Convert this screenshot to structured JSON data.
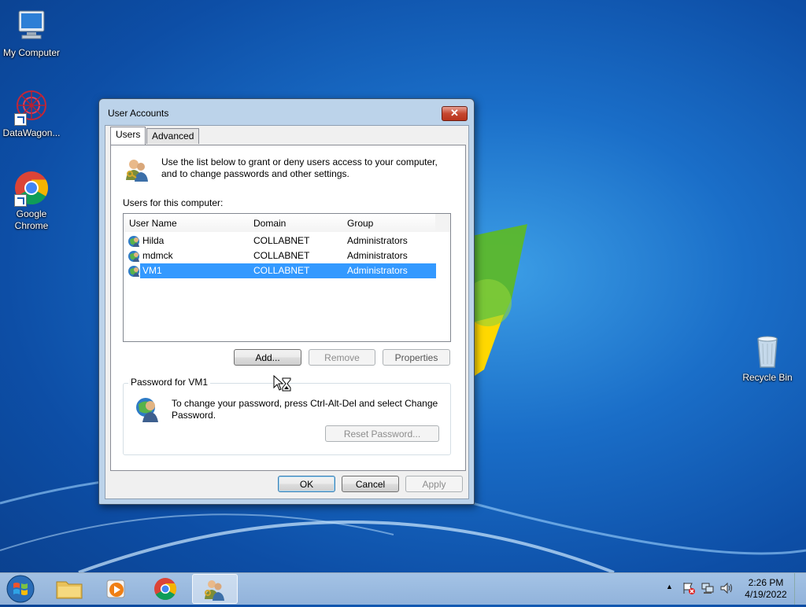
{
  "desktop": {
    "icons": [
      {
        "label": "My Computer",
        "icon": "computer-icon"
      },
      {
        "label": "DataWagon...",
        "icon": "datawagon-icon"
      },
      {
        "label": "Google Chrome",
        "icon": "chrome-icon"
      },
      {
        "label": "Recycle Bin",
        "icon": "recycle-bin-icon"
      }
    ]
  },
  "window": {
    "title": "User Accounts",
    "close_label": "✕",
    "tabs": [
      {
        "label": "Users",
        "active": true
      },
      {
        "label": "Advanced",
        "active": false
      }
    ],
    "info_text": "Use the list below to grant or deny users access to your computer, and to change passwords and other settings.",
    "users_label": "Users for this computer:",
    "columns": [
      "User Name",
      "Domain",
      "Group"
    ],
    "users": [
      {
        "name": "Hilda",
        "domain": "COLLABNET",
        "group": "Administrators",
        "selected": false
      },
      {
        "name": "mdmck",
        "domain": "COLLABNET",
        "group": "Administrators",
        "selected": false
      },
      {
        "name": "VM1",
        "domain": "COLLABNET",
        "group": "Administrators",
        "selected": true
      }
    ],
    "buttons": {
      "add": "Add...",
      "remove": "Remove",
      "properties": "Properties"
    },
    "password_group": {
      "label": "Password for VM1",
      "text": "To change your password, press Ctrl-Alt-Del and select Change Password.",
      "reset_button": "Reset Password..."
    },
    "footer": {
      "ok": "OK",
      "cancel": "Cancel",
      "apply": "Apply"
    }
  },
  "taskbar": {
    "items": [
      "start-orb",
      "windows-explorer",
      "windows-media-player",
      "google-chrome",
      "user-accounts"
    ],
    "clock": {
      "time": "2:26 PM",
      "date": "4/19/2022"
    },
    "tray_arrow": "▲"
  }
}
